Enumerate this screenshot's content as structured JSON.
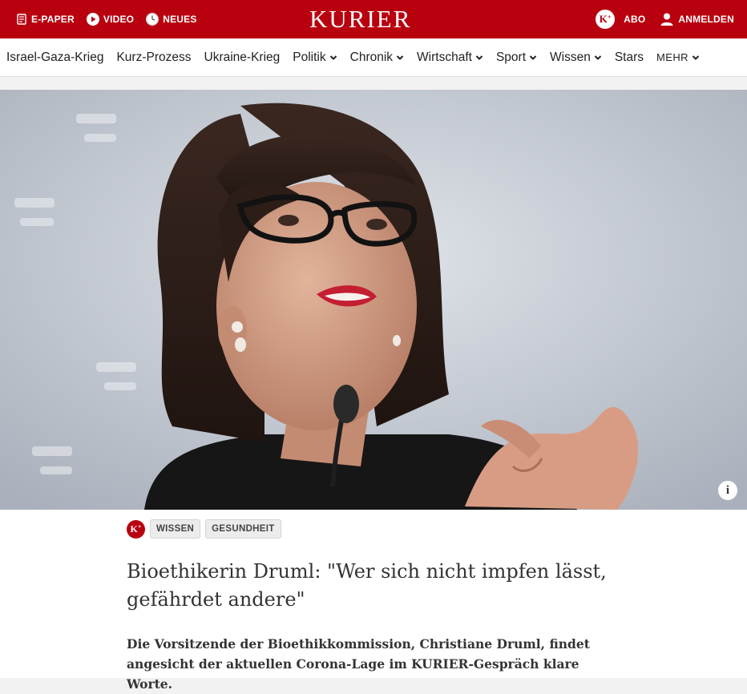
{
  "topbar": {
    "epaper_label": "E-PAPER",
    "video_label": "VIDEO",
    "neues_label": "NEUES",
    "logo": "KURIER",
    "abo_label": "ABO",
    "login_label": "ANMELDEN",
    "kplus_letter": "K",
    "kplus_sup": "+"
  },
  "nav": {
    "items": [
      {
        "label": "Israel-Gaza-Krieg"
      },
      {
        "label": "Kurz-Prozess"
      },
      {
        "label": "Ukraine-Krieg"
      },
      {
        "label": "Politik"
      },
      {
        "label": "Chronik"
      },
      {
        "label": "Wirtschaft"
      },
      {
        "label": "Sport"
      },
      {
        "label": "Wissen"
      },
      {
        "label": "Stars"
      },
      {
        "label": "MEHR"
      }
    ]
  },
  "hero": {
    "info_label": "i"
  },
  "article": {
    "tags": [
      "WISSEN",
      "GESUNDHEIT"
    ],
    "headline": "Bioethikerin Druml: \"Wer sich nicht impfen lässt, gefährdet andere\"",
    "lead": "Die Vorsitzende der Bioethikkommission, Christiane Druml, findet angesicht der aktuellen Corona-Lage im KURIER-Gespräch klare Worte."
  },
  "colors": {
    "brand": "#b8000f",
    "text": "#333333"
  }
}
